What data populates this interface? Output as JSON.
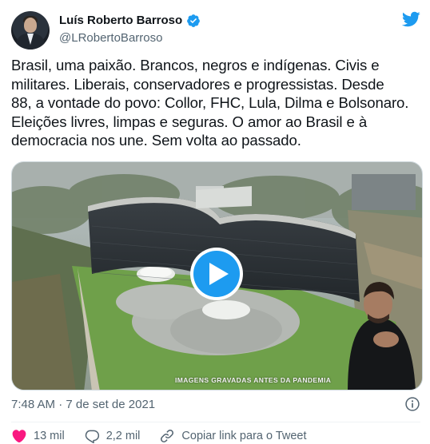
{
  "author": {
    "display_name": "Luís Roberto Barroso",
    "handle": "@LRobertoBarroso",
    "verified": true
  },
  "tweet": {
    "lines": [
      "Brasil, uma paixão. Brancos, negros e indígenas. Civis e",
      "militares. Liberais, conservadores e progressistas. Desde",
      "88, a vontade do povo: Collor, FHC, Lula, Dilma e Bolsonaro.",
      "Eleições livres, limpas e seguras. O amor ao Brasil e à",
      "democracia nos une. Sem volta ao passado."
    ]
  },
  "media": {
    "type": "video",
    "caption": "Imagens gravadas antes da pandemia",
    "play_icon": "play-icon"
  },
  "meta": {
    "timestamp": "7:48 AM · 7 de set de 2021",
    "info_icon": "info-icon"
  },
  "actions": {
    "like_count": "13 mil",
    "reply_count": "2,2 mil",
    "copy_link_label": "Copiar link para o Tweet"
  },
  "colors": {
    "accent": "#1d9bf0",
    "like": "#f91880",
    "text": "#0f1419",
    "secondary": "#536471"
  }
}
